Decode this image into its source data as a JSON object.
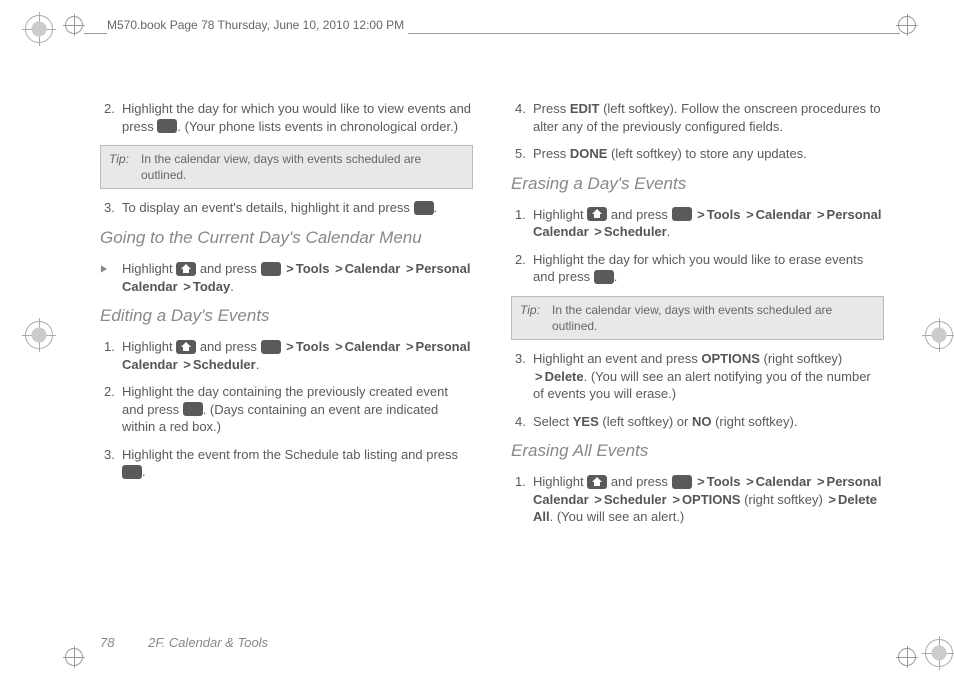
{
  "header": "M570.book  Page 78  Thursday, June 10, 2010  12:00 PM",
  "left": {
    "step2": "Highlight the day for which you would like to view events and press ",
    "step2b": ". (Your phone lists events in chronological order.)",
    "tip_label": "Tip:",
    "tip_text": "In the calendar view, days with events scheduled are outlined.",
    "step3": "To display an event's details, highlight it and press ",
    "step3b": ".",
    "h1": "Going to the Current Day's Calendar Menu",
    "bullet1a": "Highlight ",
    "bullet1b": " and press ",
    "tools": "Tools",
    "calendar": "Calendar",
    "personal": "Personal Calendar",
    "today": "Today",
    "h2": "Editing a Day's Events",
    "e_step1a": "Highlight ",
    "e_step1b": " and press ",
    "scheduler": "Scheduler",
    "e_step2": "Highlight the day containing the previously created event and press ",
    "e_step2b": ". (Days containing an event are indicated within a red box.)",
    "e_step3": "Highlight the event from the Schedule tab listing and press ",
    "e_step3b": "."
  },
  "right": {
    "step4a": "Press ",
    "edit": "EDIT",
    "step4b": " (left softkey). Follow the onscreen procedures to alter any of the previously configured fields.",
    "step5a": "Press ",
    "done": "DONE",
    "step5b": " (left softkey) to store any updates.",
    "h1": "Erasing a Day's Events",
    "d_step1a": "Highlight ",
    "d_step1b": " and press ",
    "tools": "Tools",
    "calendar": "Calendar",
    "personal": "Personal Calendar",
    "scheduler": "Scheduler",
    "d_step2": "Highlight the day for which you would like to erase events and press ",
    "d_step2b": ".",
    "tip_label": "Tip:",
    "tip_text": "In the calendar view, days with events scheduled are outlined.",
    "d_step3a": "Highlight an event and press ",
    "options": "OPTIONS",
    "d_step3b": " (right softkey) ",
    "delete": "Delete",
    "d_step3c": ". (You will see an alert notifying you of the number of events you will erase.)",
    "d_step4a": "Select ",
    "yes": "YES",
    "d_step4b": " (left softkey) or ",
    "no": "NO",
    "d_step4c": " (right softkey).",
    "h2": "Erasing All Events",
    "a_step1a": "Highlight ",
    "a_step1b": " and press ",
    "a_right": " (right softkey) ",
    "deleteall": "Delete All",
    "a_end": ". (You will see an alert.)"
  },
  "footer": {
    "pageno": "78",
    "section": "2F. Calendar & Tools"
  },
  "nums": {
    "n1": "1.",
    "n2": "2.",
    "n3": "3.",
    "n4": "4.",
    "n5": "5."
  },
  "gt": ">"
}
